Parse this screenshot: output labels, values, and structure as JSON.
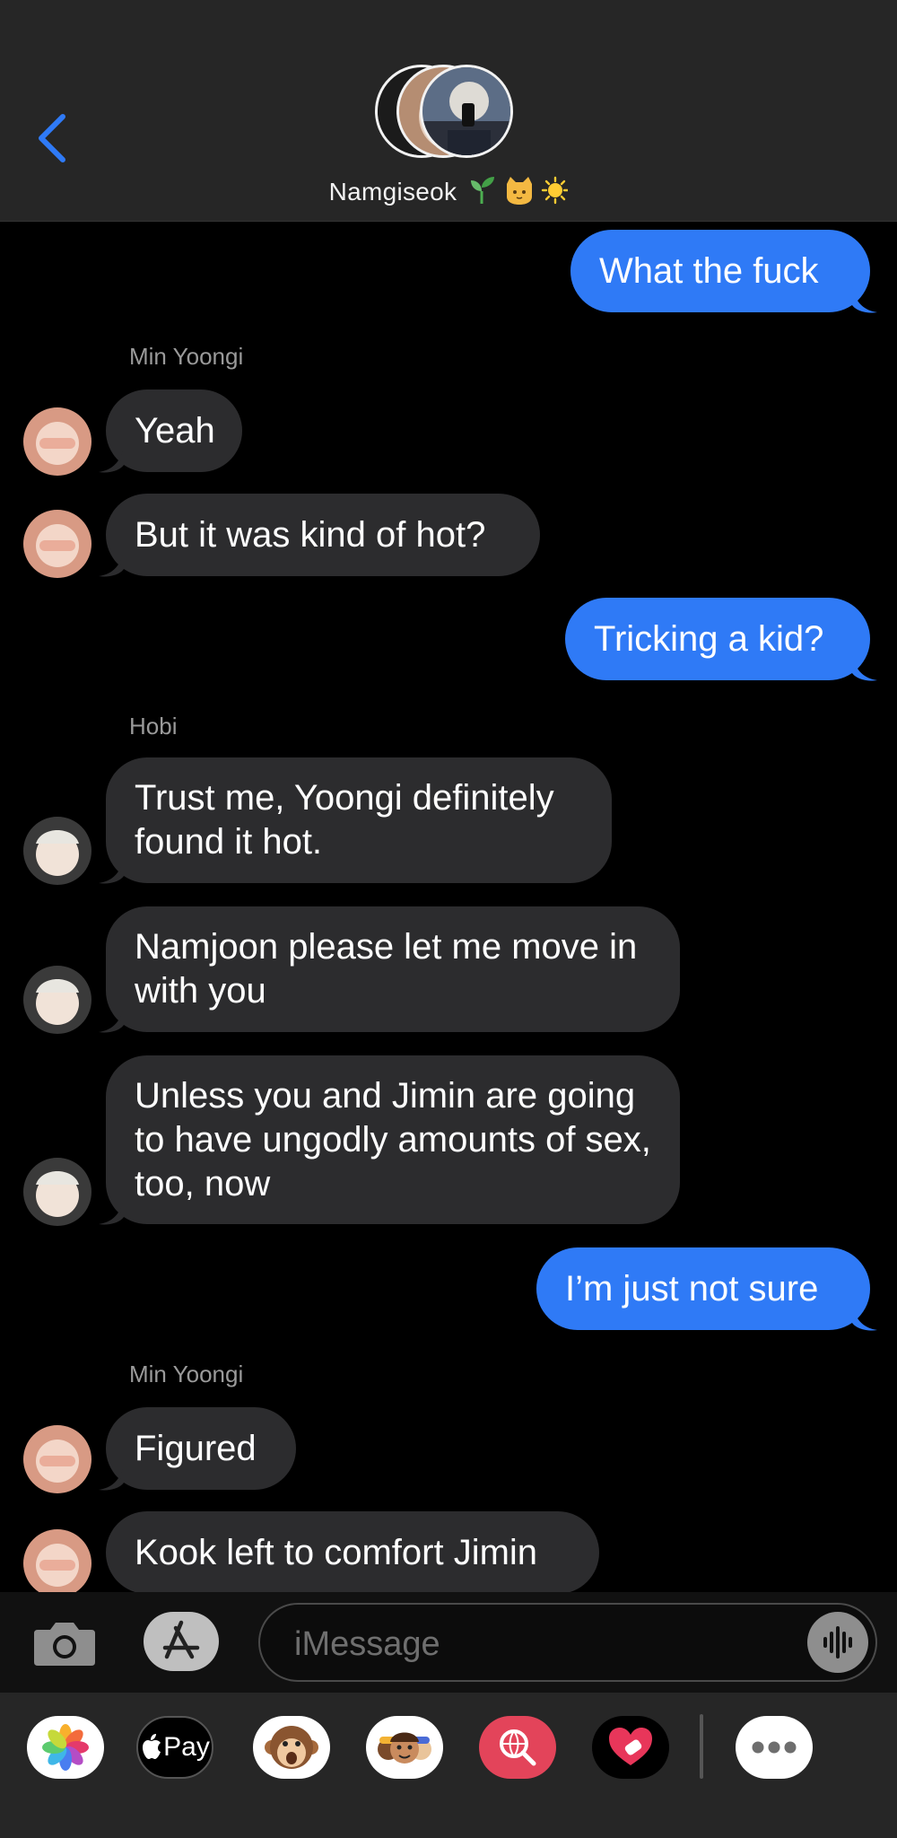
{
  "header": {
    "group_name": "Namgiseok",
    "name_emoji": [
      "sprout-emoji",
      "cat-emoji",
      "sun-emoji"
    ]
  },
  "messages": [
    {
      "direction": "outgoing",
      "text": "What the fuck"
    },
    {
      "direction": "incoming",
      "sender": "Min Yoongi",
      "text": "Yeah"
    },
    {
      "direction": "incoming",
      "text": "But it was kind of hot?"
    },
    {
      "direction": "outgoing",
      "text": "Tricking a kid?"
    },
    {
      "direction": "incoming",
      "sender": "Hobi",
      "text": "Trust me, Yoongi definitely found it hot."
    },
    {
      "direction": "incoming",
      "text": "Namjoon please let me move in with you"
    },
    {
      "direction": "incoming",
      "text": "Unless you and Jimin are going to have ungodly amounts of sex, too, now"
    },
    {
      "direction": "outgoing",
      "text": "I’m just not sure"
    },
    {
      "direction": "incoming",
      "sender": "Min Yoongi",
      "text": "Figured"
    },
    {
      "direction": "incoming",
      "text": "Kook left to comfort Jimin"
    }
  ],
  "input": {
    "placeholder": "iMessage"
  },
  "drawer": {
    "apple_pay_label": "Pay",
    "apps": [
      "photos-icon",
      "apple-pay-icon",
      "monkey-memoji-icon",
      "memoji-stickers-icon",
      "web-search-icon",
      "digital-touch-icon",
      "more-apps-icon"
    ]
  },
  "colors": {
    "outgoing_bubble": "#2f7af6",
    "incoming_bubble": "#2c2c2e",
    "accent_back": "#2f7af6"
  }
}
